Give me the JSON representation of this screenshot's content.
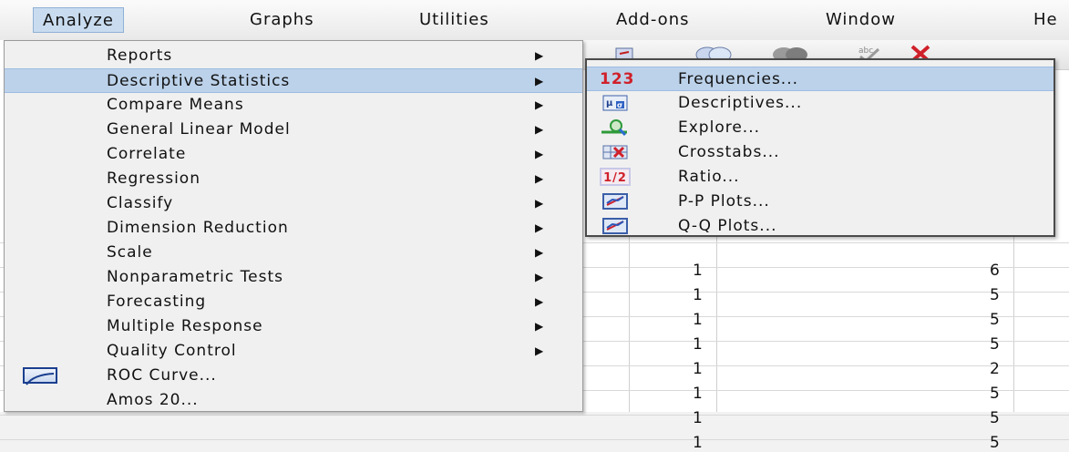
{
  "menubar": {
    "items": [
      "Analyze",
      "Graphs",
      "Utilities",
      "Add-ons",
      "Window",
      "He"
    ]
  },
  "analyze_menu": {
    "items": [
      {
        "label": "Reports",
        "has_submenu": true
      },
      {
        "label": "Descriptive Statistics",
        "has_submenu": true,
        "highlighted": true
      },
      {
        "label": "Compare Means",
        "has_submenu": true
      },
      {
        "label": "General Linear Model",
        "has_submenu": true
      },
      {
        "label": "Correlate",
        "has_submenu": true
      },
      {
        "label": "Regression",
        "has_submenu": true
      },
      {
        "label": "Classify",
        "has_submenu": true
      },
      {
        "label": "Dimension Reduction",
        "has_submenu": true
      },
      {
        "label": "Scale",
        "has_submenu": true
      },
      {
        "label": "Nonparametric Tests",
        "has_submenu": true
      },
      {
        "label": "Forecasting",
        "has_submenu": true
      },
      {
        "label": "Multiple Response",
        "has_submenu": true
      },
      {
        "label": "Quality Control",
        "has_submenu": true
      },
      {
        "label": "ROC Curve...",
        "has_submenu": false,
        "icon": "roc-curve-icon"
      },
      {
        "label": "Amos 20...",
        "has_submenu": false
      }
    ],
    "submenu_arrow": "▶"
  },
  "descriptive_submenu": {
    "items": [
      {
        "label": "Frequencies...",
        "icon": "frequencies-icon",
        "icon_text": "123",
        "highlighted": true
      },
      {
        "label": "Descriptives...",
        "icon": "descriptives-icon",
        "icon_text": ""
      },
      {
        "label": "Explore...",
        "icon": "explore-icon",
        "icon_text": ""
      },
      {
        "label": "Crosstabs...",
        "icon": "crosstabs-icon",
        "icon_text": ""
      },
      {
        "label": "Ratio...",
        "icon": "ratio-icon",
        "icon_text": "1/2"
      },
      {
        "label": "P-P Plots...",
        "icon": "pp-plots-icon",
        "icon_text": ""
      },
      {
        "label": "Q-Q Plots...",
        "icon": "qq-plots-icon",
        "icon_text": ""
      }
    ]
  },
  "grid": {
    "rows": [
      {
        "a": "1",
        "b": "6"
      },
      {
        "a": "1",
        "b": "5"
      },
      {
        "a": "1",
        "b": "5"
      },
      {
        "a": "1",
        "b": "5"
      },
      {
        "a": "1",
        "b": "2"
      },
      {
        "a": "1",
        "b": "5"
      },
      {
        "a": "1",
        "b": "5"
      },
      {
        "a": "1",
        "b": "5"
      }
    ]
  },
  "colors": {
    "highlight": "#bcd2ea",
    "accent_red": "#d0202a",
    "accent_blue": "#1b3f8f"
  }
}
